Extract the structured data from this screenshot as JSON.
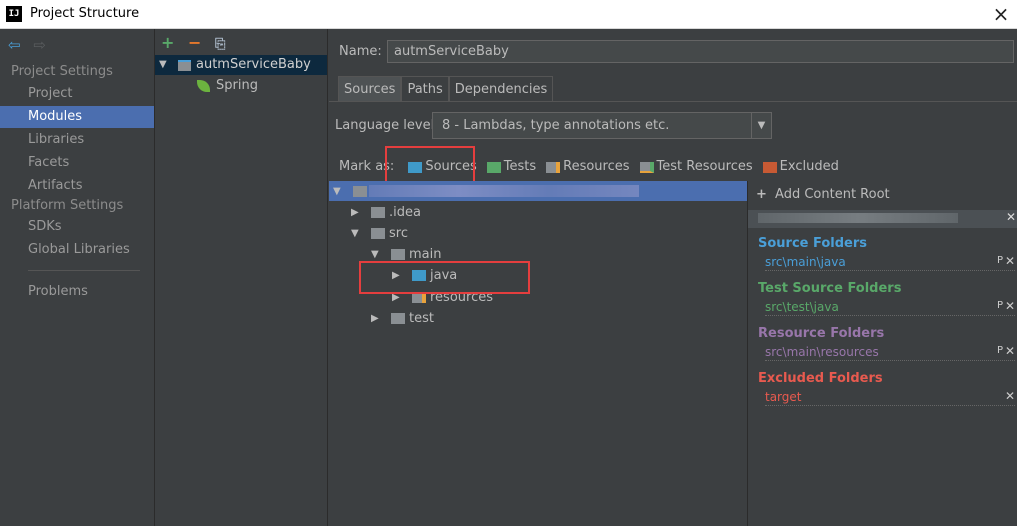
{
  "window": {
    "title": "Project Structure",
    "app_icon_text": "IJ",
    "close_icon": "×"
  },
  "nav": {
    "back_icon": "⇦",
    "forward_icon": "⇨",
    "project_settings_header": "Project Settings",
    "project_items": [
      "Project",
      "Modules",
      "Libraries",
      "Facets",
      "Artifacts"
    ],
    "platform_settings_header": "Platform Settings",
    "platform_items": [
      "SDKs",
      "Global Libraries"
    ],
    "problems": "Problems",
    "selected": "Modules"
  },
  "modules": {
    "toolbar": {
      "add": "+",
      "remove": "−",
      "copy": "⎘"
    },
    "module_name": "autmServiceBaby",
    "facet_name": "Spring"
  },
  "main": {
    "name_label": "Name:",
    "name_value": "autmServiceBaby",
    "tabs": [
      "Sources",
      "Paths",
      "Dependencies"
    ],
    "language_level_label": "Language level:",
    "language_level_value": "8 - Lambdas, type annotations etc.",
    "mark_as_label": "Mark as:",
    "mark_as": [
      "Sources",
      "Tests",
      "Resources",
      "Test Resources",
      "Excluded"
    ],
    "tree": {
      "idea": ".idea",
      "src": "src",
      "main": "main",
      "java": "java",
      "resources": "resources",
      "test": "test"
    },
    "content_roots": {
      "add_label": "Add Content Root",
      "source_folders_header": "Source Folders",
      "source_folders_path": "src\\main\\java",
      "test_source_folders_header": "Test Source Folders",
      "test_source_folders_path": "src\\test\\java",
      "resource_folders_header": "Resource Folders",
      "resource_folders_path": "src\\main\\resources",
      "excluded_folders_header": "Excluded Folders",
      "excluded_folders_path": "target",
      "props_glyph": "P",
      "remove_glyph": "✕"
    }
  },
  "colors": {
    "source": "#4a9fd8",
    "test": "#59a869",
    "resource": "#9876aa",
    "excluded": "#e85a4f",
    "selection": "#4b6eaf",
    "highlight_box": "#e53e3e"
  }
}
